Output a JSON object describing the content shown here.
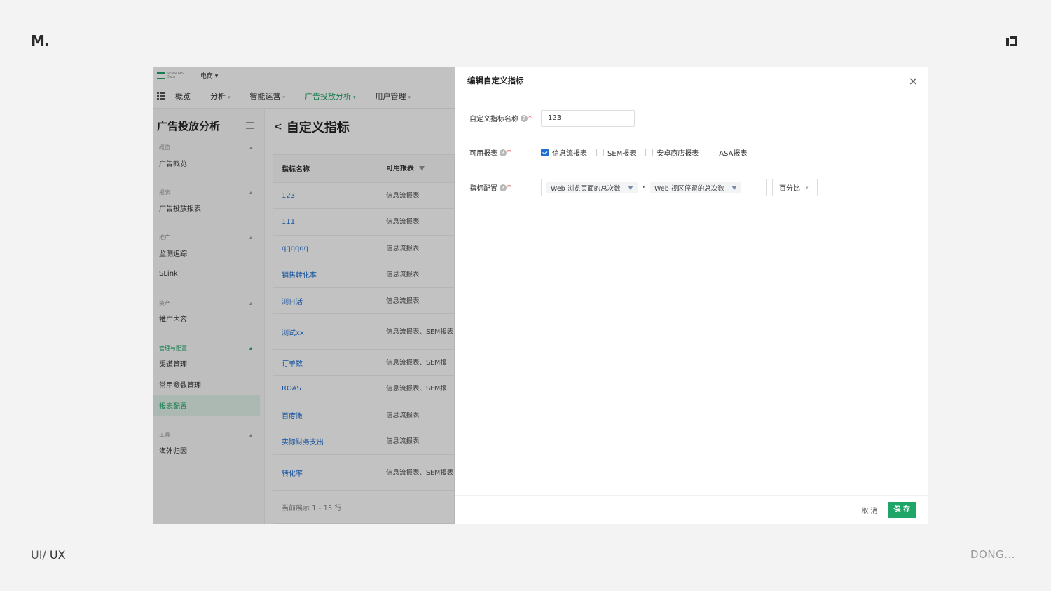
{
  "brand": "M.",
  "footer": {
    "left_prefix": "UI/",
    "left_main": "UX",
    "right": "DONG..."
  },
  "app": {
    "logo_line1": "SENSORS",
    "logo_line2": "Data",
    "tenant": "电商 ▾",
    "nav": [
      {
        "label": "概览",
        "dropdown": false,
        "active": false
      },
      {
        "label": "分析",
        "dropdown": true,
        "active": false
      },
      {
        "label": "智能运营",
        "dropdown": true,
        "active": false
      },
      {
        "label": "广告投放分析",
        "dropdown": true,
        "active": true
      },
      {
        "label": "用户管理",
        "dropdown": true,
        "active": false
      }
    ],
    "sidebar": {
      "title": "广告投放分析",
      "groups": [
        {
          "header": "概览",
          "items": [
            "广告概览"
          ]
        },
        {
          "header": "报表",
          "items": [
            "广告投放报表"
          ]
        },
        {
          "header": "推广",
          "items": [
            "监测追踪",
            "SLink"
          ]
        },
        {
          "header": "资产",
          "items": [
            "推广内容"
          ]
        },
        {
          "header": "管理与配置",
          "items": [
            "渠道管理",
            "常用参数管理",
            "报表配置"
          ]
        },
        {
          "header": "工具",
          "items": [
            "海外归因"
          ]
        }
      ],
      "active_item": "报表配置"
    },
    "main": {
      "back": "<",
      "title": "自定义指标",
      "columns": [
        "指标名称",
        "可用报表"
      ],
      "rows": [
        {
          "name": "123",
          "reports": "信息流报表",
          "h": 37
        },
        {
          "name": "111",
          "reports": "信息流报表",
          "h": 38
        },
        {
          "name": "qqqqqq",
          "reports": "信息流报表",
          "h": 37
        },
        {
          "name": "销售转化率",
          "reports": "信息流报表",
          "h": 38
        },
        {
          "name": "测日活",
          "reports": "信息流报表",
          "h": 37
        },
        {
          "name": "测试xx",
          "reports": "信息流报表、SEM报表",
          "h": 51
        },
        {
          "name": "订单数",
          "reports": "信息流报表、SEM报",
          "h": 37
        },
        {
          "name": "ROAS",
          "reports": "信息流报表、SEM报",
          "h": 38
        },
        {
          "name": "百度撒",
          "reports": "信息流报表",
          "h": 37
        },
        {
          "name": "实际财务支出",
          "reports": "信息流报表",
          "h": 38
        },
        {
          "name": "转化率",
          "reports": "信息流报表、SEM报表",
          "h": 51
        }
      ],
      "footer": "当前展示 1 - 15 行"
    }
  },
  "drawer": {
    "title": "编辑自定义指标",
    "close": "×",
    "name_label": "自定义指标名称",
    "name_value": "123",
    "reports_label": "可用报表",
    "report_options": [
      {
        "label": "信息流报表",
        "checked": true
      },
      {
        "label": "SEM报表",
        "checked": false
      },
      {
        "label": "安卓商店报表",
        "checked": false
      },
      {
        "label": "ASA报表",
        "checked": false
      }
    ],
    "config_label": "指标配置",
    "metric_a": "Web 浏览页面的总次数",
    "operator": "•",
    "metric_b": "Web 视区停留的总次数",
    "format": "百分比",
    "cancel": "取 消",
    "save": "保 存"
  },
  "colors": {
    "accent": "#1fa567",
    "link": "#1f6fd1",
    "required": "#e22233"
  },
  "icons": [
    "grid-icon",
    "collapse-icon",
    "help-icon",
    "filter-icon",
    "close-icon",
    "chevron-down-icon"
  ]
}
